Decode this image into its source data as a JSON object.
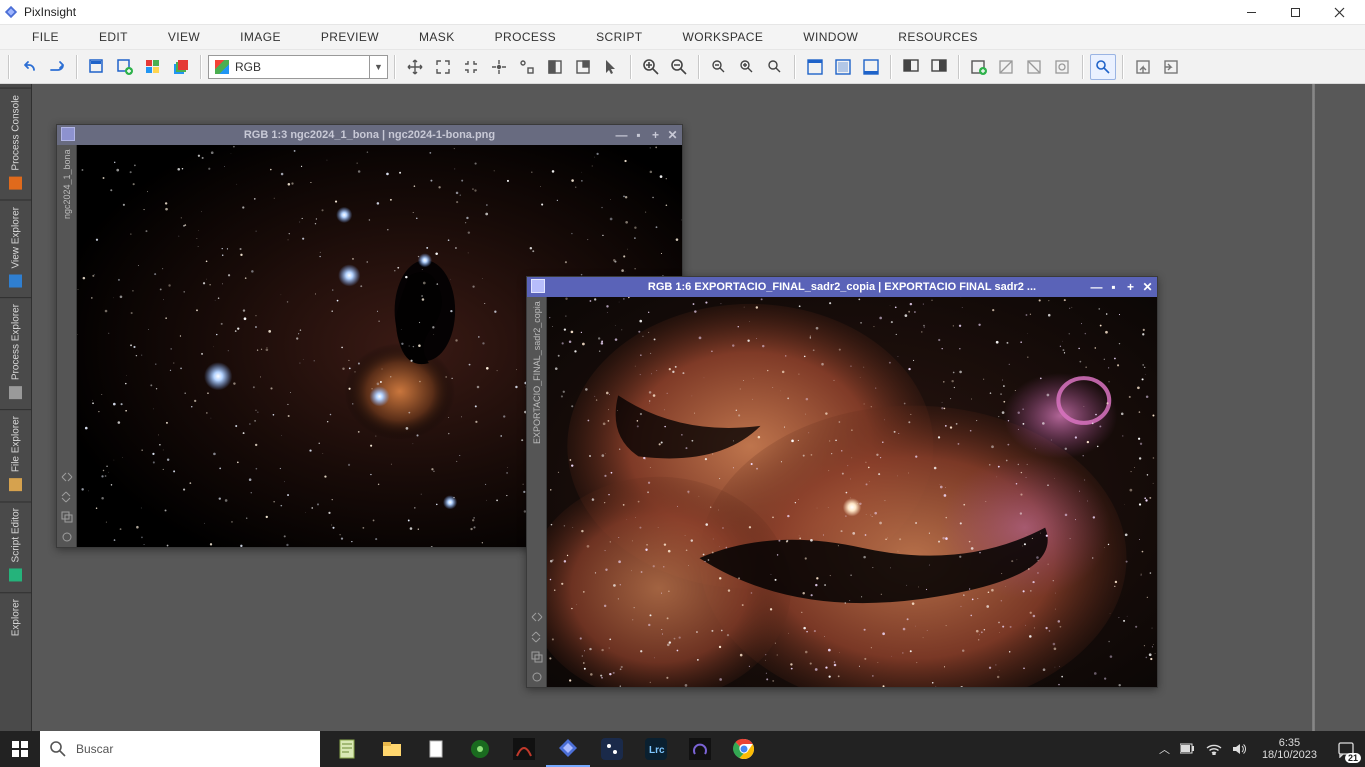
{
  "app": {
    "title": "PixInsight"
  },
  "menu": {
    "items": [
      "FILE",
      "EDIT",
      "VIEW",
      "IMAGE",
      "PREVIEW",
      "MASK",
      "PROCESS",
      "SCRIPT",
      "WORKSPACE",
      "WINDOW",
      "RESOURCES"
    ]
  },
  "toolbar": {
    "channel_selector": "RGB"
  },
  "sidebar": {
    "tabs": [
      {
        "label": "Process Console",
        "color": "#e06a1c"
      },
      {
        "label": "View Explorer",
        "color": "#2f7fd1"
      },
      {
        "label": "Process Explorer",
        "color": "#9a9a9a"
      },
      {
        "label": "File Explorer",
        "color": "#d6a24e"
      },
      {
        "label": "Script Editor",
        "color": "#25b37b"
      },
      {
        "label": "Explorer",
        "color": "#9a9a9a"
      }
    ]
  },
  "windows": {
    "w1": {
      "title": "RGB 1:3 ngc2024_1_bona | ngc2024-1-bona.png",
      "strip_label": "ngc2024_1_bona"
    },
    "w2": {
      "title": "RGB 1:6 EXPORTACIO_FINAL_sadr2_copia | EXPORTACIO FINAL sadr2 ...",
      "strip_label": "EXPORTACIO_FINAL_sadr2_copia"
    }
  },
  "taskbar": {
    "search_placeholder": "Buscar",
    "time": "6:35",
    "date": "18/10/2023",
    "badge": "21"
  }
}
